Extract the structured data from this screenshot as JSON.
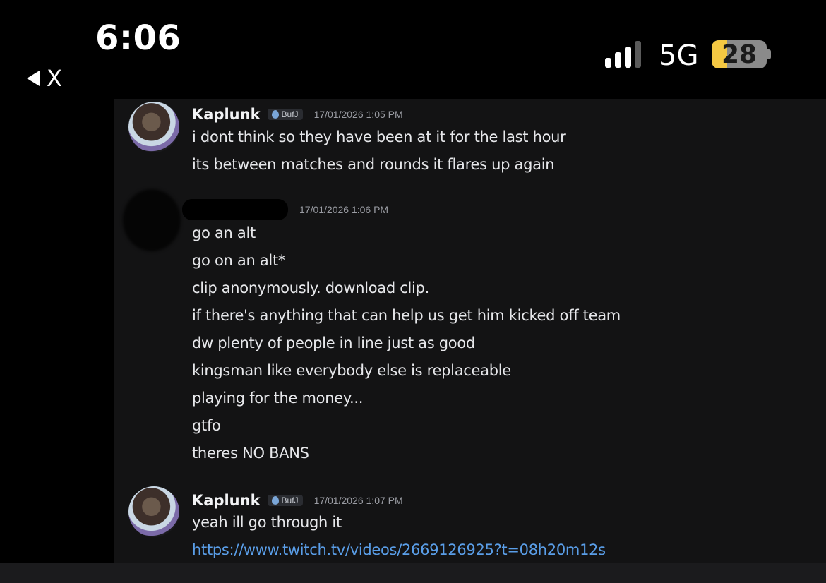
{
  "status_bar": {
    "time": "6:06",
    "back_label": "X",
    "network": "5G",
    "battery_level": "28",
    "battery_fraction": 0.28,
    "signal_bars_active": 3,
    "signal_bars_total": 4
  },
  "messages": [
    {
      "author": "Kaplunk",
      "tag": "BufJ",
      "timestamp": "17/01/2026 1:05 PM",
      "lines": [
        "i dont think so they have been at it for the last hour",
        "its between matches and rounds it flares up again"
      ]
    },
    {
      "author": "",
      "timestamp": "17/01/2026 1:06 PM",
      "lines": [
        "go an alt",
        "go on an alt*",
        "clip anonymously. download clip.",
        "if there's anything that can help us get him kicked off team",
        "dw plenty of people in line just as good",
        "kingsman like everybody else is replaceable",
        "playing for the money...",
        "gtfo",
        "theres NO BANS"
      ]
    },
    {
      "author": "Kaplunk",
      "tag": "BufJ",
      "timestamp": "17/01/2026 1:07 PM",
      "lines": [
        "yeah ill go through it"
      ],
      "link": "https://www.twitch.tv/videos/2669126925?t=08h20m12s"
    }
  ],
  "colors": {
    "background": "#000000",
    "panel": "#131314",
    "link": "#5a9ee8",
    "battery_fill": "#f5c842"
  }
}
